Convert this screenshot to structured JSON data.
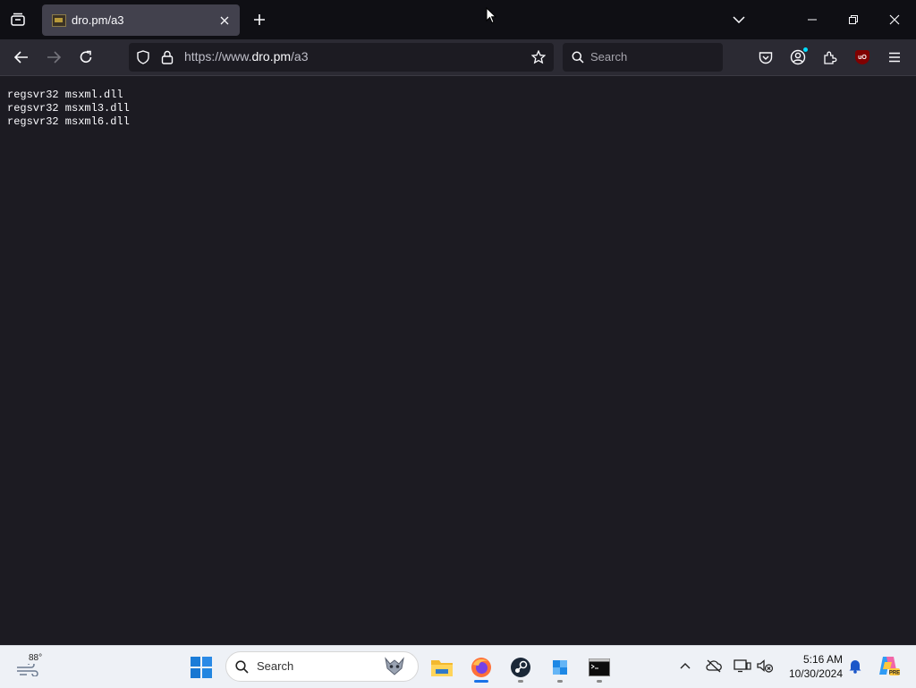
{
  "browser": {
    "tab": {
      "title": "dro.pm/a3"
    },
    "url": {
      "prefix": "https://www.",
      "domain": "dro.pm",
      "path": "/a3"
    },
    "search": {
      "placeholder": "Search"
    },
    "extension_badge": "uO"
  },
  "page": {
    "lines": [
      "regsvr32 msxml.dll",
      "regsvr32 msxml3.dll",
      "regsvr32 msxml6.dll"
    ]
  },
  "taskbar": {
    "weather_temp": "88°",
    "search_label": "Search",
    "time": "5:16 AM",
    "date": "10/30/2024"
  },
  "icons": {
    "accent": "#1a73e8",
    "firefox": "#ff7139",
    "ublock": "#800000"
  }
}
